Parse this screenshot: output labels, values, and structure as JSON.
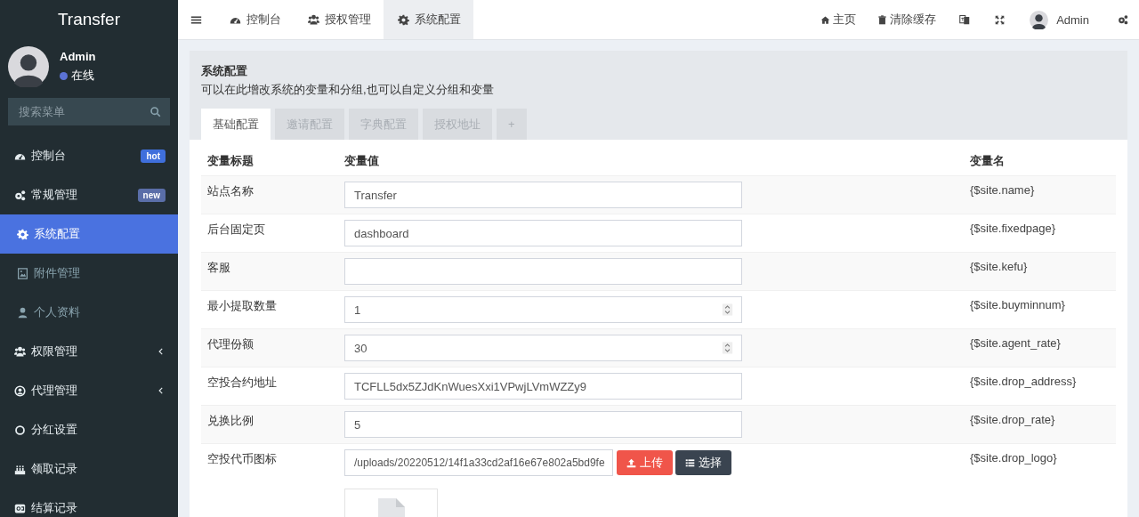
{
  "app": {
    "title": "Transfer"
  },
  "user": {
    "name": "Admin",
    "status": "在线",
    "online": true
  },
  "sidebar": {
    "search": {
      "placeholder": "搜索菜单"
    },
    "items": [
      {
        "label": "控制台",
        "kind": "menu",
        "selected": false,
        "badge": {
          "text": "hot",
          "color": "#3f6fdc"
        }
      },
      {
        "label": "常规管理",
        "kind": "menu",
        "selected": false,
        "badge": {
          "text": "new",
          "color": "#5a6ea8"
        }
      },
      {
        "label": "系统配置",
        "kind": "sub",
        "selected": true
      },
      {
        "label": "附件管理",
        "kind": "sub",
        "selected": false
      },
      {
        "label": "个人资料",
        "kind": "sub",
        "selected": false
      },
      {
        "label": "权限管理",
        "kind": "menu",
        "selected": false,
        "expanded": false
      },
      {
        "label": "代理管理",
        "kind": "menu",
        "selected": false,
        "expanded": false
      },
      {
        "label": "分红设置",
        "kind": "menu",
        "selected": false
      },
      {
        "label": "领取记录",
        "kind": "menu",
        "selected": false
      },
      {
        "label": "结算记录",
        "kind": "menu",
        "selected": false
      }
    ]
  },
  "header": {
    "tabs": [
      {
        "label": "控制台",
        "selected": false
      },
      {
        "label": "授权管理",
        "selected": false
      },
      {
        "label": "系统配置",
        "selected": true
      }
    ],
    "links": [
      {
        "label": "主页"
      },
      {
        "label": "清除缓存"
      }
    ],
    "user": {
      "name": "Admin"
    }
  },
  "panel": {
    "title": "系统配置",
    "description": "可以在此增改系统的变量和分组,也可以自定义分组和变量",
    "tabs": [
      {
        "label": "基础配置",
        "selected": true
      },
      {
        "label": "邀请配置",
        "selected": false
      },
      {
        "label": "字典配置",
        "selected": false
      },
      {
        "label": "授权地址",
        "selected": false
      },
      {
        "label": "+",
        "selected": false
      }
    ],
    "table": {
      "columns": [
        "变量标题",
        "变量值",
        "变量名"
      ],
      "rows": [
        {
          "title": "站点名称",
          "kind": "text",
          "value": "Transfer",
          "variable": "{$site.name}"
        },
        {
          "title": "后台固定页",
          "kind": "text",
          "value": "dashboard",
          "variable": "{$site.fixedpage}"
        },
        {
          "title": "客服",
          "kind": "text",
          "variable": "{$site.kefu}"
        },
        {
          "title": "最小提取数量",
          "kind": "number",
          "value": "1",
          "variable": "{$site.buyminnum}"
        },
        {
          "title": "代理份额",
          "kind": "number",
          "value": "30",
          "variable": "{$site.agent_rate}"
        },
        {
          "title": "空投合约地址",
          "kind": "text",
          "value": "TCFLL5dx5ZJdKnWuesXxi1VPwjLVmWZZy9",
          "variable": "{$site.drop_address}"
        },
        {
          "title": "兑换比例",
          "kind": "text",
          "value": "5",
          "variable": "{$site.drop_rate}"
        },
        {
          "title": "空投代币图标",
          "kind": "file",
          "value": "/uploads/20220512/14f1a33cd2af16e67e802a5bd9fe",
          "buttons": [
            "上传",
            "选择"
          ],
          "variable": "{$site.drop_logo}"
        }
      ]
    }
  }
}
